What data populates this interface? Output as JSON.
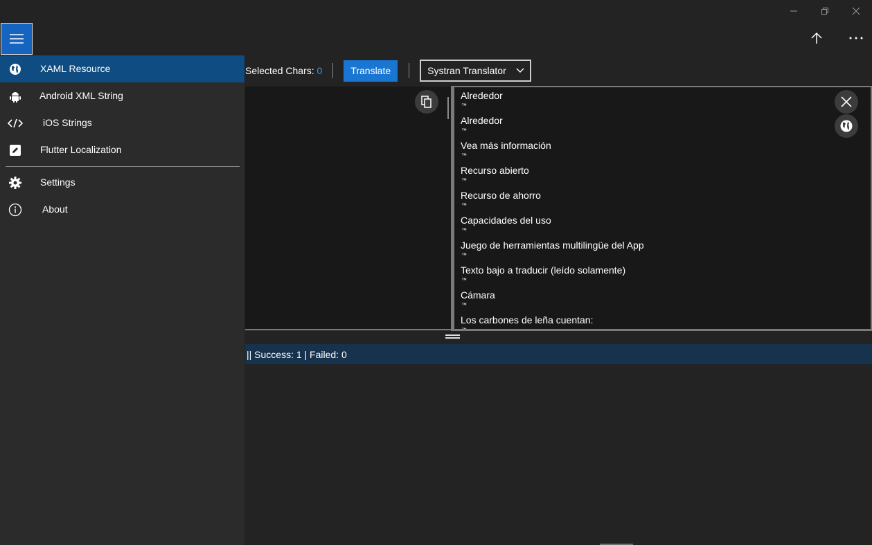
{
  "nav": {
    "items": [
      {
        "label": "XAML Resource",
        "icon": "globe-icon",
        "selected": true
      },
      {
        "label": "Android XML String",
        "icon": "android-icon"
      },
      {
        "label": "iOS Strings",
        "icon": "code-icon"
      },
      {
        "label": "Flutter Localization",
        "icon": "edit-icon"
      }
    ],
    "footer_items": [
      {
        "label": "Settings",
        "icon": "gear-icon"
      },
      {
        "label": "About",
        "icon": "info-icon"
      }
    ]
  },
  "toolbar": {
    "selected_chars_label": "Selected Chars:",
    "selected_chars_value": "0",
    "translate_label": "Translate",
    "translator_selected": "Systran Translator"
  },
  "output": {
    "lines": [
      "Alrededor",
      "Alrededor",
      "Vea más información",
      "Recurso abierto",
      "Recurso de ahorro",
      "Capacidades del uso",
      "Juego de herramientas multilingüe del App",
      "Texto bajo a traducir (leído solamente)",
      "Cámara",
      "Los carbones de leña cuentan:"
    ],
    "tm_mark": "™"
  },
  "status": {
    "text": "|| Success: 1 | Failed: 0"
  },
  "colors": {
    "accent": "#1976d2",
    "nav_selected": "#0f4c81",
    "status_bg": "#16324d",
    "count_blue": "#3a96dd"
  }
}
